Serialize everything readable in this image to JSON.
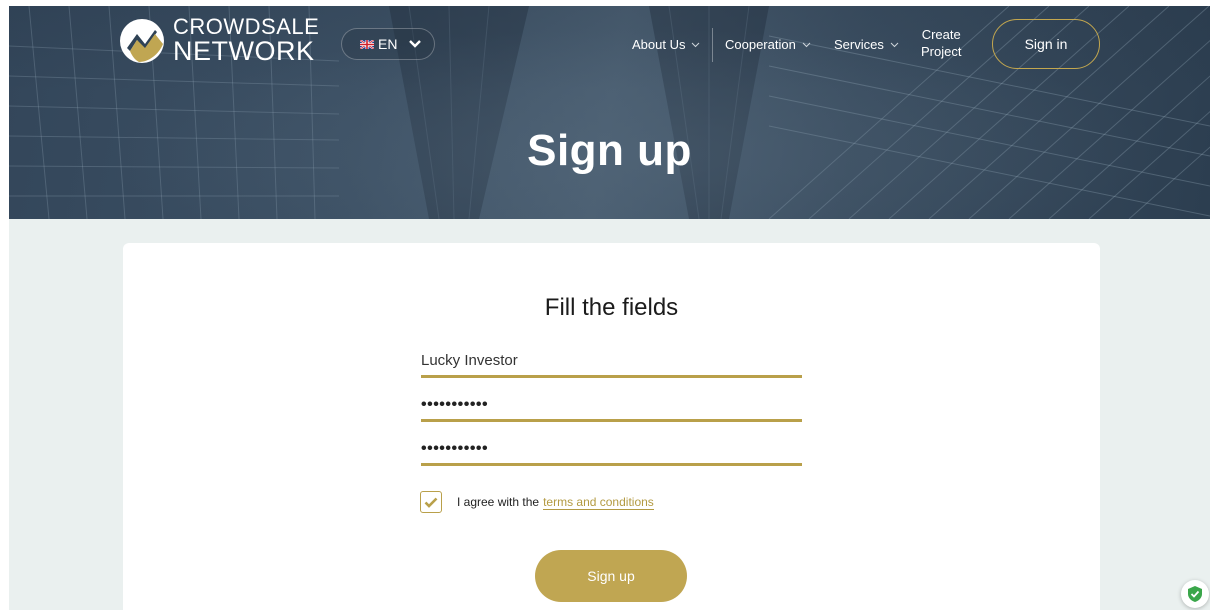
{
  "brand": {
    "line1": "CROWDSALE",
    "line2": "NETWORK"
  },
  "language": {
    "selected": "EN"
  },
  "nav": {
    "about": "About Us",
    "cooperation": "Cooperation",
    "services": "Services",
    "create_line1": "Create",
    "create_line2": "Project",
    "signin": "Sign in"
  },
  "hero": {
    "title": "Sign up"
  },
  "form": {
    "title": "Fill the fields",
    "name_value": "Lucky Investor",
    "password_value": "•••••••••••",
    "confirm_value": "•••••••••••",
    "agree_text": "I agree with the",
    "terms_link": "terms and conditions",
    "agree_checked": true,
    "submit": "Sign up"
  },
  "colors": {
    "accent": "#c0a652",
    "hero": "#3c5064",
    "page_bg": "#eaf0ef"
  }
}
